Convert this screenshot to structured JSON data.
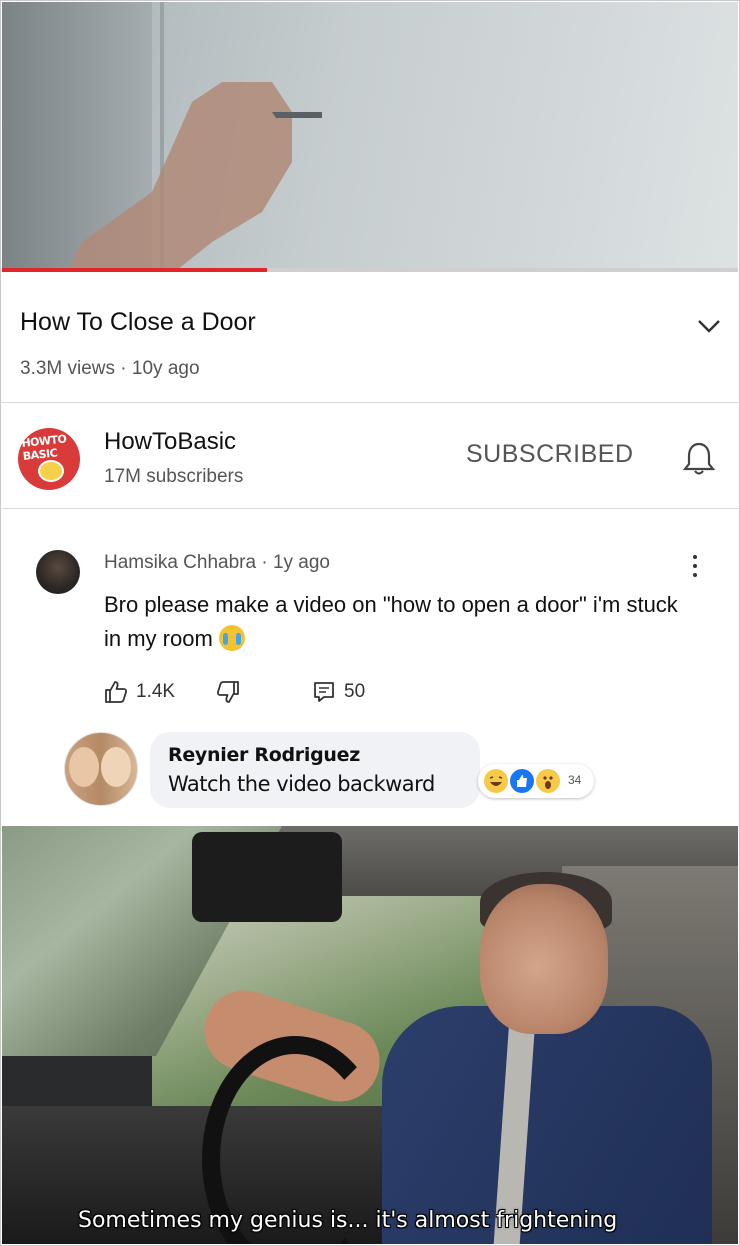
{
  "video": {
    "progress_percent": 36,
    "title": "How To Close a Door",
    "meta": "3.3M views · 10y ago"
  },
  "channel": {
    "name": "HowToBasic",
    "subscribers": "17M subscribers",
    "logo_text": "HOWTO BASIC",
    "subscribe_label": "SUBSCRIBED"
  },
  "comment": {
    "author_line": "Hamsika Chhabra · 1y ago",
    "text": "Bro please make a video on \"how to open a door\" i'm stuck in my room",
    "likes": "1.4K",
    "replies": "50"
  },
  "reply": {
    "name": "Reynier Rodriguez",
    "text": "Watch the video backward",
    "reaction_count": "34"
  },
  "meme": {
    "caption": "Sometimes my genius is... it's almost frightening"
  },
  "colors": {
    "progress": "#e1262a",
    "brand_red": "#d93a3a",
    "fb_like": "#1877f2"
  }
}
